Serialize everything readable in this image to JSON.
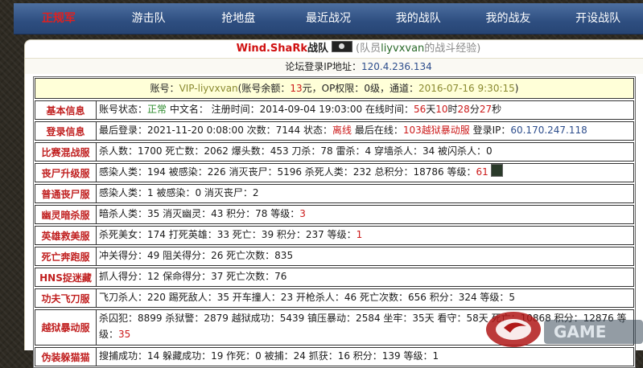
{
  "nav": {
    "items": [
      {
        "label": "正规军",
        "active": true
      },
      {
        "label": "游击队",
        "active": false
      },
      {
        "label": "抢地盘",
        "active": false
      },
      {
        "label": "最近战况",
        "active": false
      },
      {
        "label": "我的战队",
        "active": false
      },
      {
        "label": "我的战友",
        "active": false
      },
      {
        "label": "开设战队",
        "active": false
      }
    ]
  },
  "header": {
    "team_name": "Wind.ShaRk",
    "team_suffix": "战队",
    "member_prefix": "(队员",
    "member_name": "liyvxvan",
    "member_suffix": "的战斗经验)",
    "ip_label": "论坛登录IP地址：",
    "ip_value": "120.4.236.134"
  },
  "account": {
    "prefix": "账号：",
    "vip": "VIP-liyvxvan",
    "balance_label": "(账号余额：",
    "balance": "13",
    "balance_unit": "元，OP权限：",
    "op": "0级，通道：",
    "date": "2016-07-16 9:30:15",
    "close": ")"
  },
  "rows": {
    "basic": {
      "label": "基本信息",
      "status_label": "账号状态：",
      "status": "正常",
      "cn_label": " 中文名： 注册时间：",
      "reg_time": "2014-09-04 19:03:00",
      "online_label": " 在线时间：",
      "d": "56",
      "d_u": "天",
      "h": "10",
      "h_u": "时",
      "m": "28",
      "m_u": "分",
      "s": "27",
      "s_u": "秒"
    },
    "login": {
      "label": "登录信息",
      "last_label": "最后登录：",
      "last_time": "2021-11-20 0:08:00",
      "count_label": " 次数：",
      "count": "7144",
      "state_label": " 次数：7144 状态：",
      "state": "离线",
      "where_label": " 最后在线：",
      "where": "103越狱暴动服",
      "ip_label": " 登录IP：",
      "ip": "60.170.247.118"
    },
    "mix": {
      "label": "比赛混战服",
      "text": "杀人数：1700 死亡数：2062 爆头数：453 刀杀：78 雷杀：4 穿墙杀人：34 被闪杀人：0"
    },
    "zombie": {
      "label": "丧尸升级服",
      "text": "感染人类：194 被感染：226 消灭丧尸：5196 杀死人类：232 总积分：18786 等级：",
      "level": "61"
    },
    "normal_zombie": {
      "label": "普通丧尸服",
      "text": "感染人类：1 被感染：0 消灭丧尸：2"
    },
    "ghost": {
      "label": "幽灵暗杀服",
      "text": "暗杀人类：35 消灭幽灵：43 积分：78 等级：",
      "level": "3"
    },
    "hero": {
      "label": "英雄救美服",
      "text": "杀死美女：174 打死英雄：33 死亡：39 积分：237 等级：",
      "level": "1"
    },
    "death_run": {
      "label": "死亡奔跑服",
      "text": "冲关得分：49 阻关得分：26 死亡次数：835"
    },
    "hns": {
      "label": "HNS捉迷藏",
      "text": "抓人得分：12 保命得分：37 死亡次数：76"
    },
    "kungfu": {
      "label": "功夫飞刀服",
      "text": "飞刀杀人：220 踢死敌人：35 开车撞人：23 开枪杀人：46 死亡次数：656 积分：324 等级：5"
    },
    "jail": {
      "label": "越狱暴动服",
      "text": "杀囚犯：8899 杀狱警：2879 越狱成功：5439 镇压暴动：2584 坐牢：35天 看守：58天 死亡：10868 积分：12876 等级：",
      "level": "35"
    },
    "disguise": {
      "label": "伪装躲猫猫",
      "text": "搜捕成功：14 躲藏成功：19 作死：0 被捕：24 抓获：16 积分：139 等级：1"
    }
  },
  "watermark": {
    "text": "GAME"
  }
}
